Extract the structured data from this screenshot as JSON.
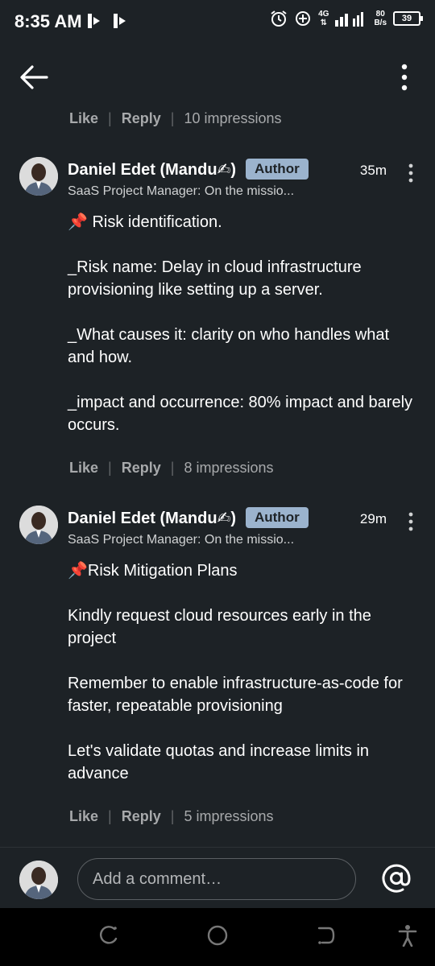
{
  "status_bar": {
    "time": "8:35 AM",
    "network_type": "4G",
    "speed_value": "80",
    "speed_unit": "B/s",
    "battery": "39"
  },
  "header": {
    "back_icon": "arrow-left-icon",
    "menu_icon": "more-vertical-icon"
  },
  "top_actions": {
    "like": "Like",
    "reply": "Reply",
    "impressions": "10 impressions"
  },
  "comments": [
    {
      "author": "Daniel Edet (Mandu✍)",
      "badge": "Author",
      "headline": "SaaS Project Manager: On the missio...",
      "time": "35m",
      "paragraphs": [
        "📌 Risk identification.",
        "_Risk name: Delay in cloud infrastructure provisioning like setting up a server.",
        "_What causes it: clarity on who handles what and how.",
        "_impact and occurrence:  80% impact and barely occurs."
      ],
      "like": "Like",
      "reply": "Reply",
      "impressions": "8 impressions"
    },
    {
      "author": "Daniel Edet (Mandu✍)",
      "badge": "Author",
      "headline": "SaaS Project Manager: On the missio...",
      "time": "29m",
      "paragraphs": [
        "📌Risk Mitigation Plans",
        "Kindly request cloud resources early in the project",
        "Remember to enable infrastructure-as-code for faster, repeatable provisioning",
        "Let's validate quotas and increase limits in advance"
      ],
      "like": "Like",
      "reply": "Reply",
      "impressions": "5 impressions"
    }
  ],
  "composer": {
    "placeholder": "Add a comment…",
    "mention_icon": "at-sign-icon"
  },
  "nav_bar": {
    "icons": [
      "recents-icon",
      "home-icon",
      "back-icon",
      "accessibility-icon"
    ]
  },
  "colors": {
    "background": "#1d2226",
    "badge": "#9bb3cd",
    "muted_text": "#a7a9ab"
  }
}
